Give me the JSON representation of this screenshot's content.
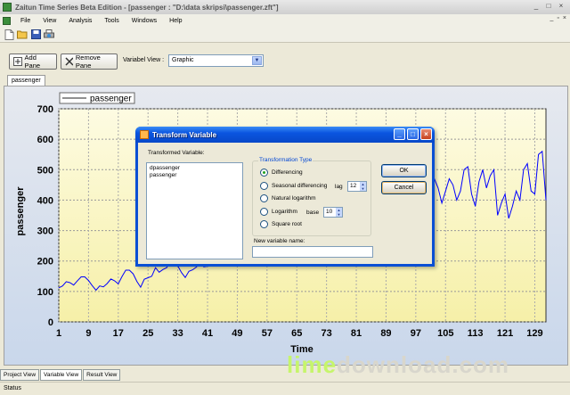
{
  "window": {
    "title": "Zaitun Time Series Beta Edition - [passenger : \"D:\\data skripsi\\passenger.zft\"]",
    "controls": [
      "_",
      "□",
      "×"
    ]
  },
  "menu": {
    "items": [
      "File",
      "View",
      "Analysis",
      "Tools",
      "Windows",
      "Help"
    ],
    "mdi_controls": [
      "_",
      "▫",
      "×"
    ]
  },
  "toolbar": {
    "icons": [
      "new-icon",
      "open-icon",
      "save-icon",
      "print-icon"
    ]
  },
  "panebar": {
    "add_pane": "Add Pane",
    "remove_pane": "Remove Pane",
    "variable_view_label": "Variabel View :",
    "variable_view_value": "Graphic"
  },
  "doc_tab": "passenger",
  "chart_data": {
    "type": "line",
    "ylabel": "passenger",
    "xlabel": "Time",
    "legend": "passenger",
    "legend_position": "top-left",
    "ylim": [
      0,
      700
    ],
    "yticks": [
      "0",
      "100",
      "200",
      "300",
      "400",
      "500",
      "600",
      "700"
    ],
    "xticks": [
      "1",
      "9",
      "17",
      "25",
      "33",
      "41",
      "49",
      "57",
      "65",
      "73",
      "81",
      "89",
      "97",
      "105",
      "113",
      "121",
      "129"
    ],
    "xlim": [
      1,
      132
    ],
    "grid": true,
    "series": [
      {
        "name": "passenger",
        "color": "#0000ff",
        "x": [
          1,
          2,
          3,
          4,
          5,
          6,
          7,
          8,
          9,
          10,
          11,
          12,
          13,
          14,
          15,
          16,
          17,
          18,
          19,
          20,
          21,
          22,
          23,
          24,
          25,
          26,
          27,
          28,
          29,
          30,
          31,
          32,
          33,
          34,
          35,
          36,
          37,
          38,
          39,
          40,
          41,
          42,
          88,
          89,
          90,
          91,
          92,
          93,
          94,
          95,
          96,
          97,
          98,
          99,
          100,
          101,
          102,
          103,
          104,
          105,
          106,
          107,
          108,
          109,
          110,
          111,
          112,
          113,
          114,
          115,
          116,
          117,
          118,
          119,
          120,
          121,
          122,
          123,
          124,
          125,
          126,
          127,
          128,
          129,
          130,
          131,
          132
        ],
        "y": [
          112,
          118,
          132,
          129,
          121,
          135,
          148,
          148,
          136,
          119,
          104,
          118,
          115,
          126,
          141,
          135,
          125,
          149,
          170,
          170,
          158,
          133,
          114,
          140,
          145,
          150,
          178,
          163,
          172,
          178,
          199,
          199,
          184,
          162,
          146,
          166,
          171,
          180,
          193,
          181,
          183,
          218,
          358,
          320,
          380,
          410,
          370,
          440,
          420,
          350,
          380,
          400,
          460,
          430,
          350,
          450,
          470,
          440,
          390,
          430,
          470,
          450,
          400,
          430,
          500,
          510,
          420,
          380,
          460,
          500,
          440,
          480,
          500,
          350,
          390,
          420,
          340,
          380,
          430,
          400,
          500,
          520,
          430,
          420,
          550,
          560,
          400
        ]
      }
    ]
  },
  "dialog": {
    "title": "Transform Variable",
    "transformed_label": "Transformed Variable:",
    "list_items": [
      "dpassenger",
      "passenger"
    ],
    "group_title": "Transformation Type",
    "options": {
      "differencing": "Differencing",
      "seasonal": "Seasonal differencing",
      "natural_log": "Natural logarithm",
      "logarithm": "Logarithm",
      "sqrt": "Square root"
    },
    "selected_option": "Differencing",
    "lag_label": "lag",
    "lag_value": "12",
    "base_label": "base",
    "base_value": "10",
    "new_name_label": "New variable name:",
    "new_name_value": "",
    "ok": "OK",
    "cancel": "Cancel"
  },
  "bottom_tabs": [
    "Project View",
    "Variable View",
    "Result View"
  ],
  "active_bottom_tab": "Variable View",
  "status": "Status",
  "watermark": {
    "lime": "lime",
    "rest": "download.com"
  }
}
